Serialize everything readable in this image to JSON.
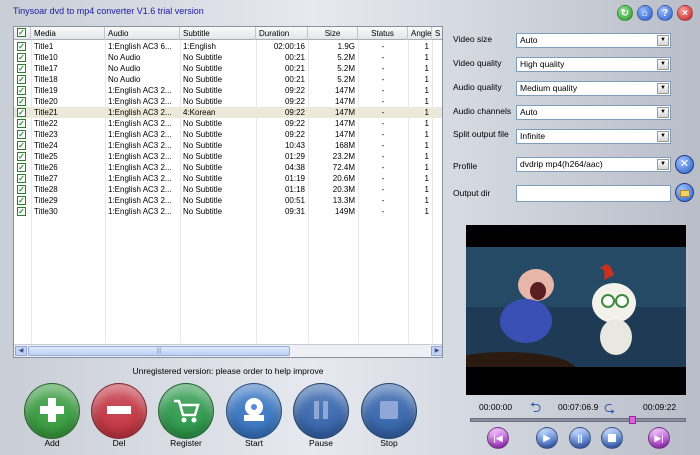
{
  "app": {
    "title": "Tinysoar dvd to mp4 converter V1.6 trial version"
  },
  "window_buttons": {
    "refresh": "refresh-icon",
    "home": "home-icon",
    "help": "?",
    "close": "×"
  },
  "table": {
    "columns": [
      "Media",
      "Audio",
      "Subtitle",
      "Duration",
      "Size",
      "Status",
      "Angle",
      "S"
    ],
    "rows": [
      {
        "checked": true,
        "media": "Title1",
        "audio": "1:English AC3 6...",
        "subtitle": "1:English",
        "duration": "02:00:16",
        "size": "1.9G",
        "status": "-",
        "angle": "1"
      },
      {
        "checked": true,
        "media": "Title10",
        "audio": "No Audio",
        "subtitle": "No Subtitle",
        "duration": "00:21",
        "size": "5.2M",
        "status": "-",
        "angle": "1"
      },
      {
        "checked": true,
        "media": "Title17",
        "audio": "No Audio",
        "subtitle": "No Subtitle",
        "duration": "00:21",
        "size": "5.2M",
        "status": "-",
        "angle": "1"
      },
      {
        "checked": true,
        "media": "Title18",
        "audio": "No Audio",
        "subtitle": "No Subtitle",
        "duration": "00:21",
        "size": "5.2M",
        "status": "-",
        "angle": "1"
      },
      {
        "checked": true,
        "media": "Title19",
        "audio": "1:English AC3 2...",
        "subtitle": "No Subtitle",
        "duration": "09:22",
        "size": "147M",
        "status": "-",
        "angle": "1"
      },
      {
        "checked": true,
        "media": "Title20",
        "audio": "1:English AC3 2...",
        "subtitle": "No Subtitle",
        "duration": "09:22",
        "size": "147M",
        "status": "-",
        "angle": "1"
      },
      {
        "checked": true,
        "media": "Title21",
        "audio": "1:English AC3 2...",
        "subtitle": "4:Korean",
        "duration": "09:22",
        "size": "147M",
        "status": "-",
        "angle": "1",
        "selected": true
      },
      {
        "checked": true,
        "media": "Title22",
        "audio": "1:English AC3 2...",
        "subtitle": "No Subtitle",
        "duration": "09:22",
        "size": "147M",
        "status": "-",
        "angle": "1"
      },
      {
        "checked": true,
        "media": "Title23",
        "audio": "1:English AC3 2...",
        "subtitle": "No Subtitle",
        "duration": "09:22",
        "size": "147M",
        "status": "-",
        "angle": "1"
      },
      {
        "checked": true,
        "media": "Title24",
        "audio": "1:English AC3 2...",
        "subtitle": "No Subtitle",
        "duration": "10:43",
        "size": "168M",
        "status": "-",
        "angle": "1"
      },
      {
        "checked": true,
        "media": "Title25",
        "audio": "1:English AC3 2...",
        "subtitle": "No Subtitle",
        "duration": "01:29",
        "size": "23.2M",
        "status": "-",
        "angle": "1"
      },
      {
        "checked": true,
        "media": "Title26",
        "audio": "1:English AC3 2...",
        "subtitle": "No Subtitle",
        "duration": "04:38",
        "size": "72.4M",
        "status": "-",
        "angle": "1"
      },
      {
        "checked": true,
        "media": "Title27",
        "audio": "1:English AC3 2...",
        "subtitle": "No Subtitle",
        "duration": "01:19",
        "size": "20.6M",
        "status": "-",
        "angle": "1"
      },
      {
        "checked": true,
        "media": "Title28",
        "audio": "1:English AC3 2...",
        "subtitle": "No Subtitle",
        "duration": "01:18",
        "size": "20.3M",
        "status": "-",
        "angle": "1"
      },
      {
        "checked": true,
        "media": "Title29",
        "audio": "1:English AC3 2...",
        "subtitle": "No Subtitle",
        "duration": "00:51",
        "size": "13.3M",
        "status": "-",
        "angle": "1"
      },
      {
        "checked": true,
        "media": "Title30",
        "audio": "1:English AC3 2...",
        "subtitle": "No Subtitle",
        "duration": "09:31",
        "size": "149M",
        "status": "-",
        "angle": "1"
      }
    ]
  },
  "notice": "Unregistered version: please order to help improve",
  "actions": [
    {
      "label": "Add",
      "icon": "plus-icon",
      "color": "#2f9a35"
    },
    {
      "label": "Del",
      "icon": "minus-icon",
      "color": "#c42b38"
    },
    {
      "label": "Register",
      "icon": "cart-icon",
      "color": "#239642"
    },
    {
      "label": "Start",
      "icon": "start-icon",
      "color": "#2d6ebf"
    },
    {
      "label": "Pause",
      "icon": "pause-icon",
      "color": "#2b5da8"
    },
    {
      "label": "Stop",
      "icon": "stop-icon",
      "color": "#2b5da8"
    }
  ],
  "settings": [
    {
      "label": "Video size",
      "value": "Auto"
    },
    {
      "label": "Video quality",
      "value": "High quality"
    },
    {
      "label": "Audio quality",
      "value": "Medium quality"
    },
    {
      "label": "Audio channels",
      "value": "Auto"
    },
    {
      "label": "Split output file",
      "value": "Infinite"
    }
  ],
  "profile": {
    "label": "Profile",
    "value": "dvdrip mp4(h264/aac)"
  },
  "output": {
    "label": "Output dir",
    "value": ""
  },
  "player": {
    "start_time": "00:00:00",
    "current_time": "00:07:06.9",
    "end_time": "00:09:22",
    "position": 0.76
  },
  "colors": {
    "accent_purple": "#a020c8",
    "player_blue": "#2e58b8"
  }
}
